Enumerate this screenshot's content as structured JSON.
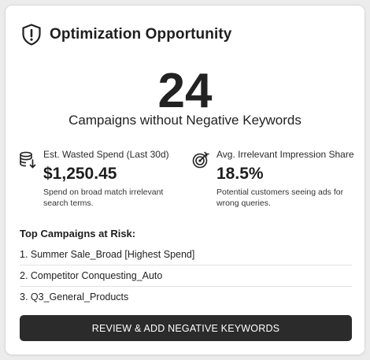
{
  "card": {
    "title": "Optimization Opportunity",
    "title_icon": "shield-alert-icon"
  },
  "headline": {
    "count": "24",
    "label": "Campaigns without Negative Keywords"
  },
  "metrics": [
    {
      "icon": "database-arrow-down-icon",
      "label": "Est. Wasted Spend (Last 30d)",
      "value": "$1,250.45",
      "description": "Spend on broad match irrelevant search terms."
    },
    {
      "icon": "target-icon",
      "label": "Avg. Irrelevant Impression Share",
      "value": "18.5%",
      "description": "Potential customers seeing ads for wrong queries."
    }
  ],
  "risk": {
    "title": "Top Campaigns at Risk:",
    "items": [
      "1. Summer Sale_Broad [Highest Spend]",
      "2. Competitor Conquesting_Auto",
      "3. Q3_General_Products"
    ]
  },
  "cta": {
    "label": "REVIEW & ADD NEGATIVE KEYWORDS"
  },
  "colors": {
    "button_bg": "#2b2b2b",
    "text": "#1f1f1f",
    "card_bg": "#ffffff"
  }
}
